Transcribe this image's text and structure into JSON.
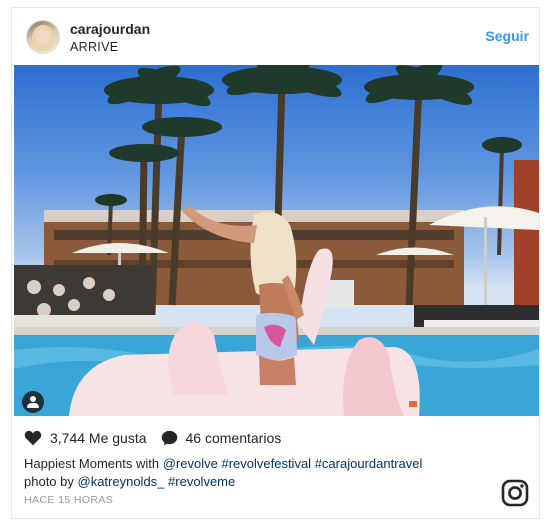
{
  "post": {
    "username": "carajourdan",
    "location": "ARRIVE",
    "follow_label": "Seguir",
    "likes": "3,744 Me gusta",
    "comments": "46 comentarios",
    "caption_text": "Happiest Moments with ",
    "caption_links": [
      "@revolve",
      "#revolvefestival",
      "#carajourdantravel"
    ],
    "caption_line2_text": "photo by ",
    "caption_line2_links": [
      "@katreynolds_",
      "#revolveme"
    ],
    "timestamp": "HACE 15 HORAS"
  },
  "icons": {
    "like": "heart-icon",
    "comment": "comment-icon",
    "tagged_users": "person-icon",
    "brand": "instagram-icon"
  },
  "colors": {
    "link": "#003569",
    "follow": "#3897f0",
    "text": "#262626",
    "muted": "#999999"
  }
}
